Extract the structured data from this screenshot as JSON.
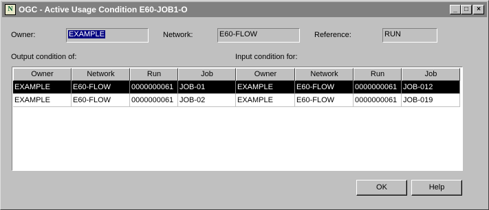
{
  "window": {
    "title": "OGC - Active Usage Condition E60-JOB1-O",
    "icon_glyph": "N",
    "controls": {
      "minimize": "_",
      "maximize": "□",
      "close": "×"
    }
  },
  "fields": {
    "owner": {
      "label": "Owner:",
      "value": "EXAMPLE"
    },
    "network": {
      "label": "Network:",
      "value": "E60-FLOW"
    },
    "reference": {
      "label": "Reference:",
      "value": "RUN"
    }
  },
  "sections": {
    "output_label": "Output condition of:",
    "input_label": "Input condition for:"
  },
  "table": {
    "columns": [
      "Owner",
      "Network",
      "Run",
      "Job",
      "Owner",
      "Network",
      "Run",
      "Job"
    ],
    "rows": [
      [
        "EXAMPLE",
        "E60-FLOW",
        "0000000061",
        "JOB-01",
        "EXAMPLE",
        "E60-FLOW",
        "0000000061",
        "JOB-012"
      ],
      [
        "EXAMPLE",
        "E60-FLOW",
        "0000000061",
        "JOB-02",
        "EXAMPLE",
        "E60-FLOW",
        "0000000061",
        "JOB-019"
      ]
    ],
    "selected_row": 0
  },
  "buttons": {
    "ok": "OK",
    "help": "Help"
  }
}
